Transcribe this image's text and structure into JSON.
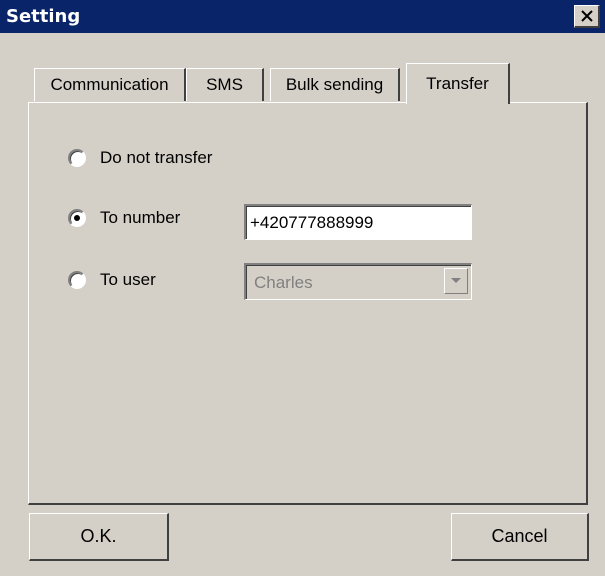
{
  "window": {
    "title": "Setting"
  },
  "tabs": [
    {
      "label": "Communication",
      "active": false
    },
    {
      "label": "SMS",
      "active": false
    },
    {
      "label": "Bulk sending",
      "active": false
    },
    {
      "label": "Transfer",
      "active": true
    }
  ],
  "transfer": {
    "options": [
      {
        "label": "Do not transfer",
        "selected": false
      },
      {
        "label": "To number",
        "selected": true
      },
      {
        "label": "To user",
        "selected": false
      }
    ],
    "number_value": "+420777888999",
    "user_value": "Charles"
  },
  "buttons": {
    "ok_label": "O.K.",
    "cancel_label": "Cancel"
  },
  "colors": {
    "titlebar": "#0a246a",
    "face": "#d4d0c8"
  }
}
